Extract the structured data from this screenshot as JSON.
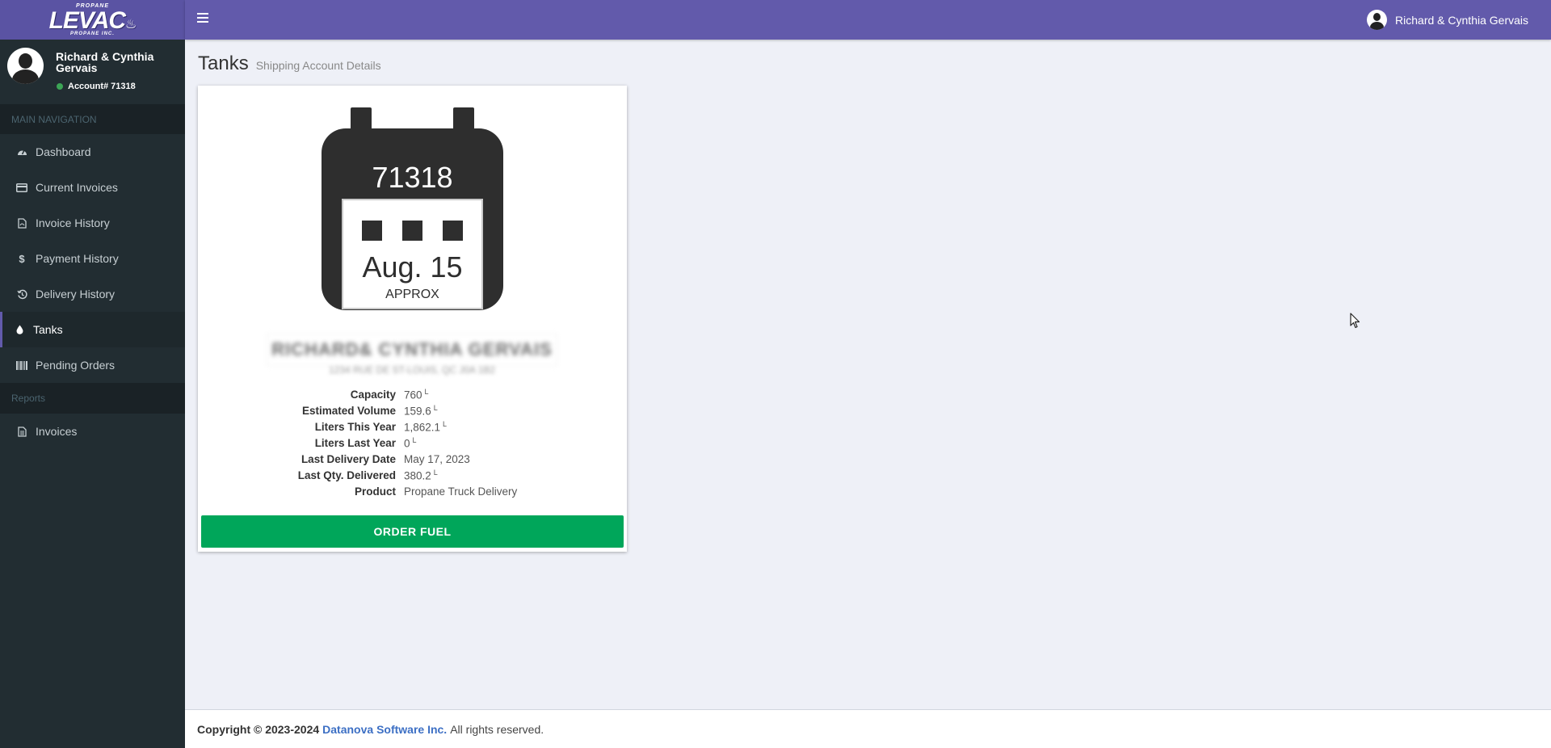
{
  "brand": {
    "logo_top": "PROPANE",
    "logo_main": "LEVAC",
    "logo_sub": "PROPANE INC."
  },
  "topbar": {
    "menu_icon": "hamburger-icon",
    "user_name": "Richard & Cynthia Gervais"
  },
  "sidebar": {
    "user": {
      "name": "Richard & Cynthia Gervais",
      "account": "Account# 71318",
      "status_color": "#3ca556"
    },
    "main_header": "MAIN NAVIGATION",
    "items": [
      {
        "label": "Dashboard",
        "icon": "dashboard-icon"
      },
      {
        "label": "Current Invoices",
        "icon": "credit-card-icon"
      },
      {
        "label": "Invoice History",
        "icon": "pdf-file-icon"
      },
      {
        "label": "Payment History",
        "icon": "dollar-icon"
      },
      {
        "label": "Delivery History",
        "icon": "history-icon"
      },
      {
        "label": "Tanks",
        "icon": "tint-icon",
        "active": true
      },
      {
        "label": "Pending Orders",
        "icon": "barcode-icon"
      }
    ],
    "reports_header": "Reports",
    "report_items": [
      {
        "label": "Invoices",
        "icon": "file-text-icon"
      }
    ]
  },
  "page": {
    "title": "Tanks",
    "subtitle": "Shipping Account Details"
  },
  "tank": {
    "number": "71318",
    "date": "Aug. 15",
    "approx": "APPROX",
    "owner_blurred": "RICHARD& CYNTHIA GERVAIS",
    "address_blurred": "1234 RUE DE ST-LOUIS, QC J0A 1B2",
    "details": [
      {
        "label": "Capacity",
        "value": "760",
        "unit": "L"
      },
      {
        "label": "Estimated Volume",
        "value": "159.6",
        "unit": "L"
      },
      {
        "label": "Liters This Year",
        "value": "1,862.1",
        "unit": "L"
      },
      {
        "label": "Liters Last Year",
        "value": "0",
        "unit": "L"
      },
      {
        "label": "Last Delivery Date",
        "value": "May 17, 2023",
        "unit": ""
      },
      {
        "label": "Last Qty. Delivered",
        "value": "380.2",
        "unit": "L"
      },
      {
        "label": "Product",
        "value": "Propane Truck Delivery",
        "unit": ""
      }
    ],
    "order_button": "ORDER FUEL"
  },
  "footer": {
    "copyright": "Copyright © 2023-2024",
    "company": "Datanova Software Inc.",
    "rights": "All rights reserved."
  },
  "colors": {
    "header": "#625aab",
    "sidebar": "#222d32",
    "order_button": "#00a65a",
    "link": "#3c6fc4"
  }
}
